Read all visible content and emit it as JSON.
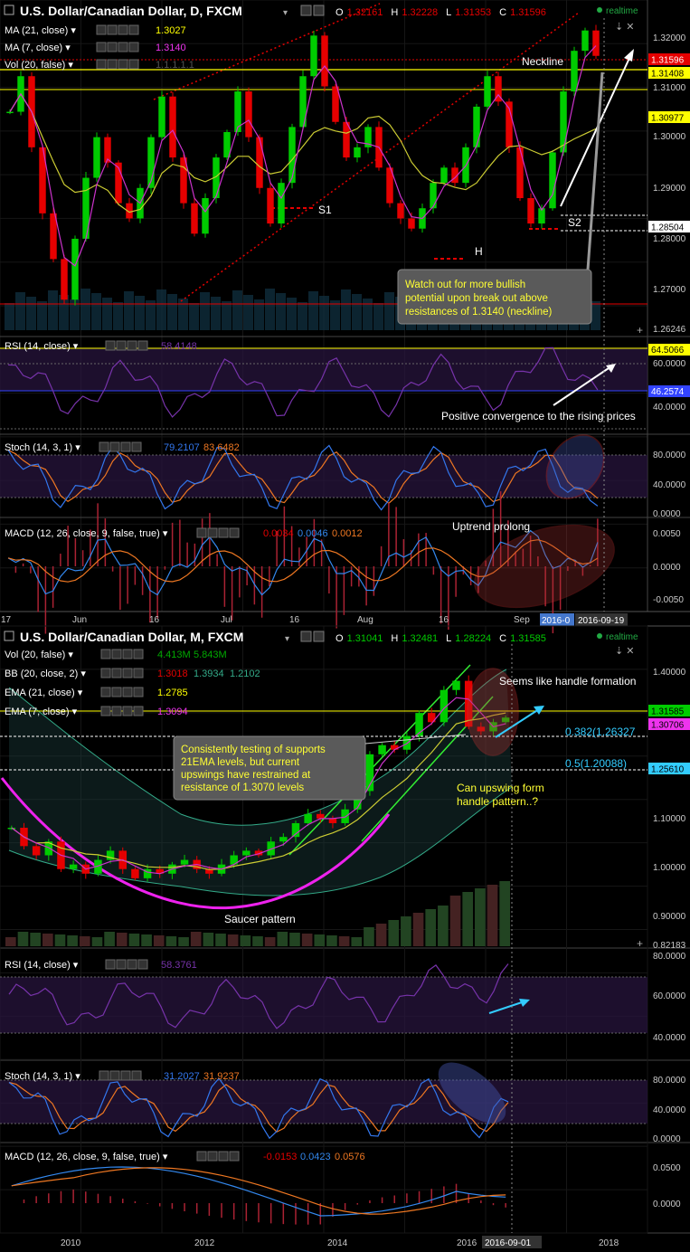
{
  "colors": {
    "bg": "#000000",
    "grid": "#1c1c1c",
    "up": "#00cc00",
    "down": "#e60000",
    "ma_fast": "#cc33cc",
    "ma_slow": "#cccc33",
    "axis_text": "#cccccc",
    "yellow": "#ffff00",
    "cyan": "#33ccff",
    "rsi": "#7733aa",
    "stoch_k": "#3377ee",
    "stoch_d": "#ee7722",
    "price_tag": "#e60000",
    "pink_tag": "#ee33ee"
  },
  "top": {
    "title": "U.S. Dollar/Canadian Dollar, D, FXCM",
    "ohlc": {
      "o_label": "O",
      "o": "1.32161",
      "h_label": "H",
      "h": "1.32228",
      "l_label": "L",
      "l": "1.31353",
      "c_label": "C",
      "c": "1.31596"
    },
    "realtime": "realtime",
    "indicators": [
      {
        "label": "MA (21, close)",
        "value": "1.3027",
        "color": "#ffff00"
      },
      {
        "label": "MA (7, close)",
        "value": "1.3140",
        "color": "#ee33ee"
      },
      {
        "label": "Vol (20, false)",
        "value": "1.1.1.1.1",
        "color": "#555555"
      }
    ],
    "price_axis": [
      "1.32000",
      "1.31000",
      "1.30000",
      "1.29000",
      "1.28000",
      "1.27000",
      "1.26246"
    ],
    "tags": [
      {
        "text": "1.31596",
        "bg": "#e60000",
        "fg": "#ffffff"
      },
      {
        "text": "1.31408",
        "bg": "#ffff00",
        "fg": "#000000"
      },
      {
        "text": "1.30977",
        "bg": "#ffff00",
        "fg": "#000000"
      },
      {
        "text": "1.28504",
        "bg": "#ffffff",
        "fg": "#000000"
      }
    ],
    "annotations": {
      "neckline": "Neckline",
      "s1": "S1",
      "s2": "S2",
      "h": "H"
    },
    "callout": [
      "Watch out for more bullish",
      "potential upon break out above",
      "resistances of 1.3140 (neckline)"
    ],
    "rsi": {
      "label": "RSI (14, close)",
      "value": "58.4148",
      "axis": [
        "60.0000",
        "40.0000"
      ],
      "tag_hi": "64.5066",
      "tag_lo": "46.2574",
      "note": "Positive convergence to the rising prices"
    },
    "stoch": {
      "label": "Stoch (14, 3, 1)",
      "k": "79.2107",
      "d": "83.6482",
      "axis": [
        "80.0000",
        "40.0000",
        "0.0000"
      ]
    },
    "macd": {
      "label": "MACD (12, 26, close, 9, false, true)",
      "v1": "0.0034",
      "v2": "0.0046",
      "v3": "0.0012",
      "axis": [
        "0.0050",
        "0.0000",
        "-0.0050"
      ],
      "note": "Uptrend prolong"
    },
    "time_axis": [
      "17",
      "Jun",
      "16",
      "Jul",
      "16",
      "Aug",
      "16",
      "Sep"
    ],
    "time_tags": [
      "2016-0",
      "2016-09-19"
    ]
  },
  "bottom": {
    "title": "U.S. Dollar/Canadian Dollar, M, FXCM",
    "ohlc": {
      "o_label": "O",
      "o": "1.31041",
      "h_label": "H",
      "h": "1.32481",
      "l_label": "L",
      "l": "1.28224",
      "c_label": "C",
      "c": "1.31585"
    },
    "realtime": "realtime",
    "indicators": [
      {
        "label": "Vol (20, false)",
        "v1": "4.413M",
        "v2": "5.843M",
        "c1": "#00aa00",
        "c2": "#00aa00",
        "v3": ""
      },
      {
        "label": "BB (20, close, 2)",
        "v1": "1.3018",
        "v2": "1.3934",
        "v3": "1.2102",
        "c1": "#e60000",
        "c2": "#33aa88"
      },
      {
        "label": "EMA (21, close)",
        "v1": "1.2785",
        "c1": "#ffff00",
        "v2": "",
        "v3": ""
      },
      {
        "label": "EMA (7, close)",
        "v1": "1.3094",
        "c1": "#ee33ee",
        "v2": "",
        "v3": ""
      }
    ],
    "price_axis": [
      "1.40000",
      "1.10000",
      "1.00000",
      "0.90000",
      "0.82183"
    ],
    "tags": [
      {
        "text": "1.31585",
        "bg": "#00cc00",
        "fg": "#000000"
      },
      {
        "text": "1.30706",
        "bg": "#ee33ee",
        "fg": "#000000"
      },
      {
        "text": "1.25610",
        "bg": "#33ccff",
        "fg": "#000000"
      }
    ],
    "fib": [
      "0.382(1.26327",
      "0.5(1.20088)"
    ],
    "annotations": {
      "handle": "Seems like handle formation",
      "saucer": "Saucer pattern",
      "question": [
        "Can upswing form",
        "handle pattern..?"
      ]
    },
    "callout": [
      "Consistently testing of supports",
      "21EMA levels, but current",
      "upswings have restrained at",
      "resistance of 1.3070 levels"
    ],
    "rsi": {
      "label": "RSI (14, close)",
      "value": "58.3761",
      "axis": [
        "80.0000",
        "60.0000",
        "40.0000"
      ]
    },
    "stoch": {
      "label": "Stoch (14, 3, 1)",
      "k": "31.2027",
      "d": "31.9237",
      "axis": [
        "80.0000",
        "40.0000",
        "0.0000"
      ]
    },
    "macd": {
      "label": "MACD (12, 26, close, 9, false, true)",
      "v1": "-0.0153",
      "v2": "0.0423",
      "v3": "0.0576",
      "axis": [
        "0.0500",
        "0.0000"
      ]
    },
    "time_axis": [
      "2010",
      "2012",
      "2014",
      "2016",
      "2018"
    ],
    "time_tags": [
      "2016-09-01"
    ]
  },
  "chart_data": [
    {
      "type": "candlestick",
      "title": "U.S. Dollar/Canadian Dollar, D, FXCM",
      "x_labels": [
        "17",
        "Jun",
        "16",
        "Jul",
        "16",
        "Aug",
        "16",
        "Sep"
      ],
      "ylim": [
        1.262,
        1.327
      ],
      "series": [
        {
          "name": "USD/CAD daily close",
          "values": [
            1.305,
            1.312,
            1.298,
            1.285,
            1.276,
            1.268,
            1.28,
            1.292,
            1.3,
            1.295,
            1.287,
            1.284,
            1.29,
            1.3,
            1.308,
            1.296,
            1.287,
            1.281,
            1.288,
            1.296,
            1.301,
            1.309,
            1.3,
            1.29,
            1.283,
            1.291,
            1.302,
            1.312,
            1.32,
            1.31,
            1.303,
            1.296,
            1.298,
            1.302,
            1.294,
            1.287,
            1.284,
            1.282,
            1.286,
            1.291,
            1.294,
            1.291,
            1.298,
            1.306,
            1.312,
            1.307,
            1.298,
            1.288,
            1.283,
            1.286,
            1.297,
            1.309,
            1.317,
            1.321,
            1.316
          ]
        }
      ],
      "levels": {
        "neckline": 1.314,
        "ma21": 1.3098,
        "s2": 1.285,
        "close": 1.31596
      }
    },
    {
      "type": "candlestick",
      "title": "U.S. Dollar/Canadian Dollar, M, FXCM",
      "x_labels": [
        "2010",
        "2012",
        "2014",
        "2016",
        "2018"
      ],
      "ylim": [
        0.82,
        1.48
      ],
      "series": [
        {
          "name": "USD/CAD monthly close",
          "values": [
            1.08,
            1.04,
            1.02,
            1.05,
            0.99,
            1.0,
            0.98,
            1.01,
            1.03,
            0.99,
            0.97,
            0.99,
            0.98,
            1.0,
            1.01,
            0.99,
            0.98,
            1.0,
            1.02,
            1.03,
            1.02,
            1.05,
            1.06,
            1.09,
            1.11,
            1.1,
            1.09,
            1.12,
            1.16,
            1.24,
            1.26,
            1.25,
            1.28,
            1.33,
            1.31,
            1.38,
            1.4,
            1.3,
            1.29,
            1.31,
            1.32
          ]
        }
      ],
      "levels": {
        "fib_0382": 1.26327,
        "fib_05": 1.20088,
        "ema7": 1.30706,
        "close": 1.31585
      }
    }
  ]
}
